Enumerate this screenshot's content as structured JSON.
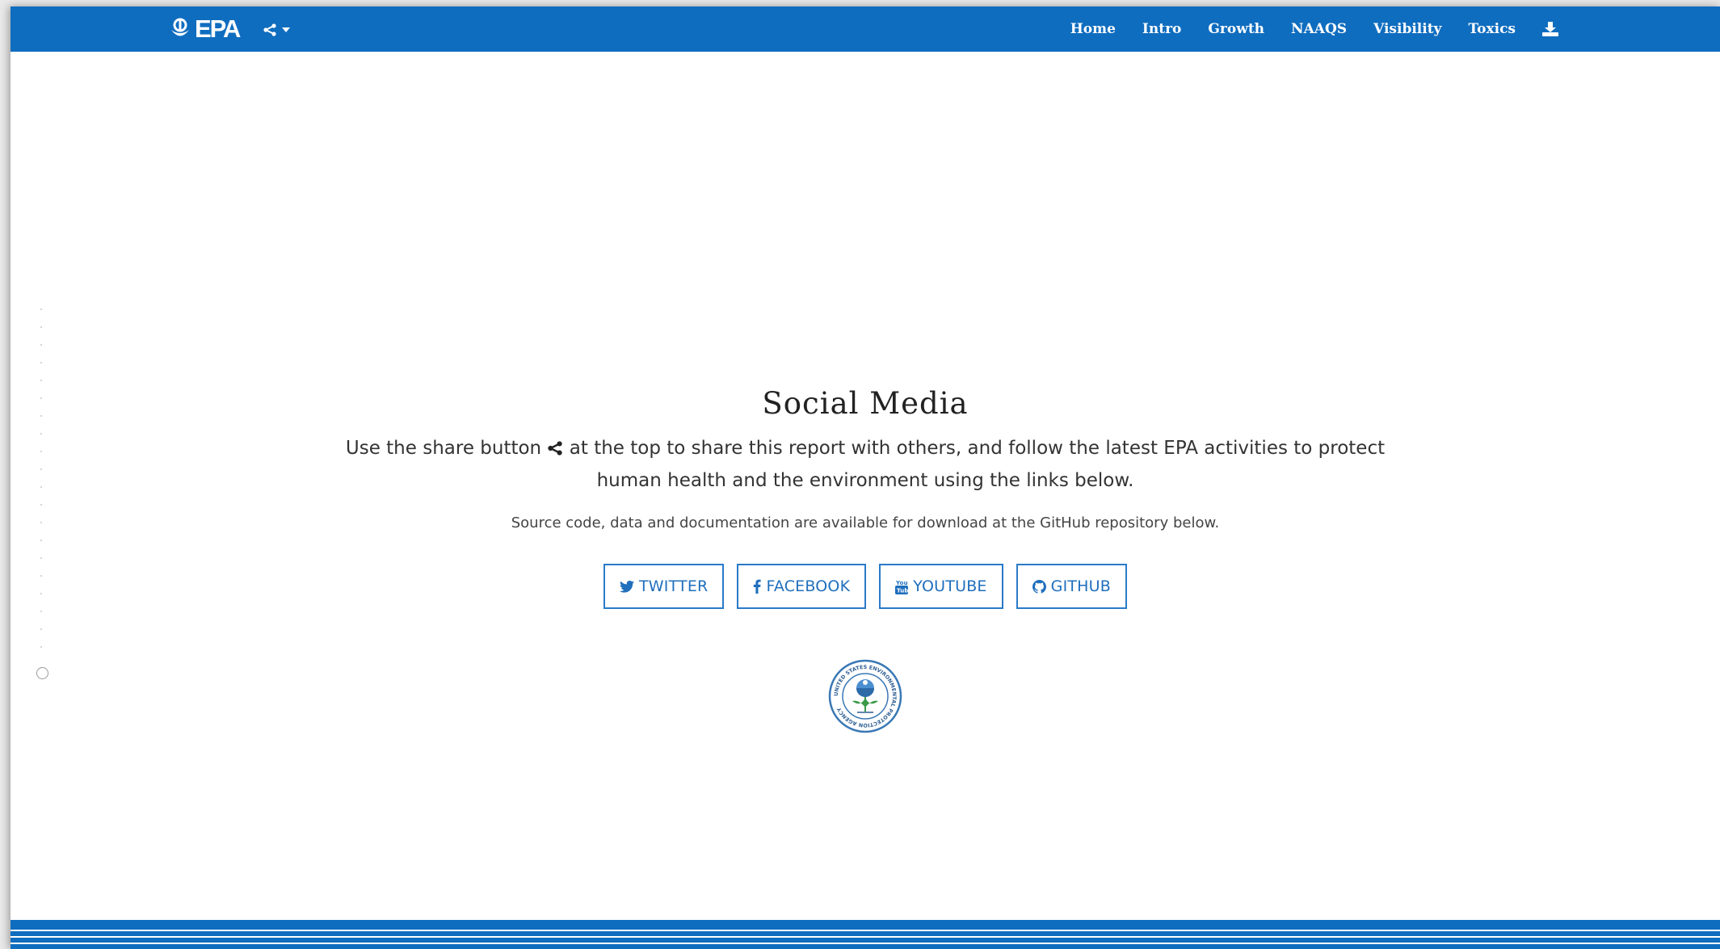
{
  "brand": {
    "logo_text": "EPA"
  },
  "nav": {
    "links": [
      "Home",
      "Intro",
      "Growth",
      "NAAQS",
      "Visibility",
      "Toxics"
    ],
    "share_icon": "share-icon",
    "download_icon": "download-icon"
  },
  "section": {
    "title": "Social Media",
    "lead_before": "Use the share button",
    "lead_after": "at the top to share this report with others, and follow the latest EPA activities to protect human health and the environment using the links below.",
    "note": "Source code, data and documentation are available for download at the GitHub repository below."
  },
  "buttons": {
    "twitter": "TWITTER",
    "facebook": "FACEBOOK",
    "youtube": "YOUTUBE",
    "github": "GITHUB"
  },
  "seal": {
    "text": "UNITED STATES ENVIRONMENTAL PROTECTION AGENCY"
  },
  "colors": {
    "brand_blue": "#0f6dbf",
    "button_blue": "#1f6fbd"
  }
}
